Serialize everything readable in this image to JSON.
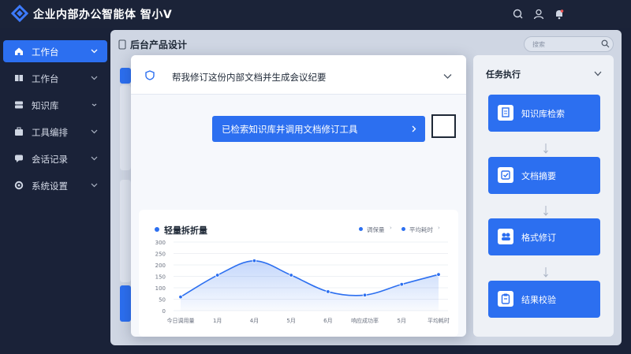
{
  "app": {
    "title": "企业内部办公智能体 智小V"
  },
  "sidebar": {
    "items": [
      {
        "label": "工作台",
        "icon": "home-icon",
        "active": true
      },
      {
        "label": "工作台",
        "icon": "book-icon",
        "active": false
      },
      {
        "label": "知识库",
        "icon": "database-icon",
        "active": false
      },
      {
        "label": "工具编排",
        "icon": "toolbox-icon",
        "active": false
      },
      {
        "label": "会话记录",
        "icon": "chat-icon",
        "active": false
      },
      {
        "label": "系统设置",
        "icon": "settings-icon",
        "active": false
      }
    ]
  },
  "main": {
    "page_title": "后台产品设计",
    "search_placeholder": "搜索"
  },
  "modal": {
    "title": "帮我修订这份内部文档并生成会议纪要",
    "action_label": "已检索知识库并调用文档修订工具"
  },
  "chart": {
    "title": "轻量拆折量",
    "legend": [
      "调保量",
      "平均耗时"
    ]
  },
  "chart_data": {
    "type": "area",
    "title": "轻量拆折量",
    "categories": [
      "今日调用量",
      "1月",
      "4月",
      "5月",
      "6月",
      "响应成功率",
      "5月",
      "平均耗时"
    ],
    "series": [
      {
        "name": "调保量",
        "values": [
          60,
          155,
          218,
          155,
          83,
          68,
          115,
          158
        ]
      }
    ],
    "yticks": [
      "0",
      "50",
      "100",
      "150",
      "200",
      "250",
      "300"
    ],
    "ylim": [
      0,
      300
    ],
    "grid": true,
    "legend_position": "top-right"
  },
  "tasks": {
    "title": "任务执行",
    "steps": [
      {
        "label": "知识库检索",
        "icon": "document-icon"
      },
      {
        "label": "文档摘要",
        "icon": "checklist-icon"
      },
      {
        "label": "格式修订",
        "icon": "users-icon"
      },
      {
        "label": "结果校验",
        "icon": "clipboard-icon"
      }
    ]
  },
  "colors": {
    "accent": "#2c6ff0",
    "topbar": "#1b2338",
    "main_bg": "#cfd6e3"
  }
}
